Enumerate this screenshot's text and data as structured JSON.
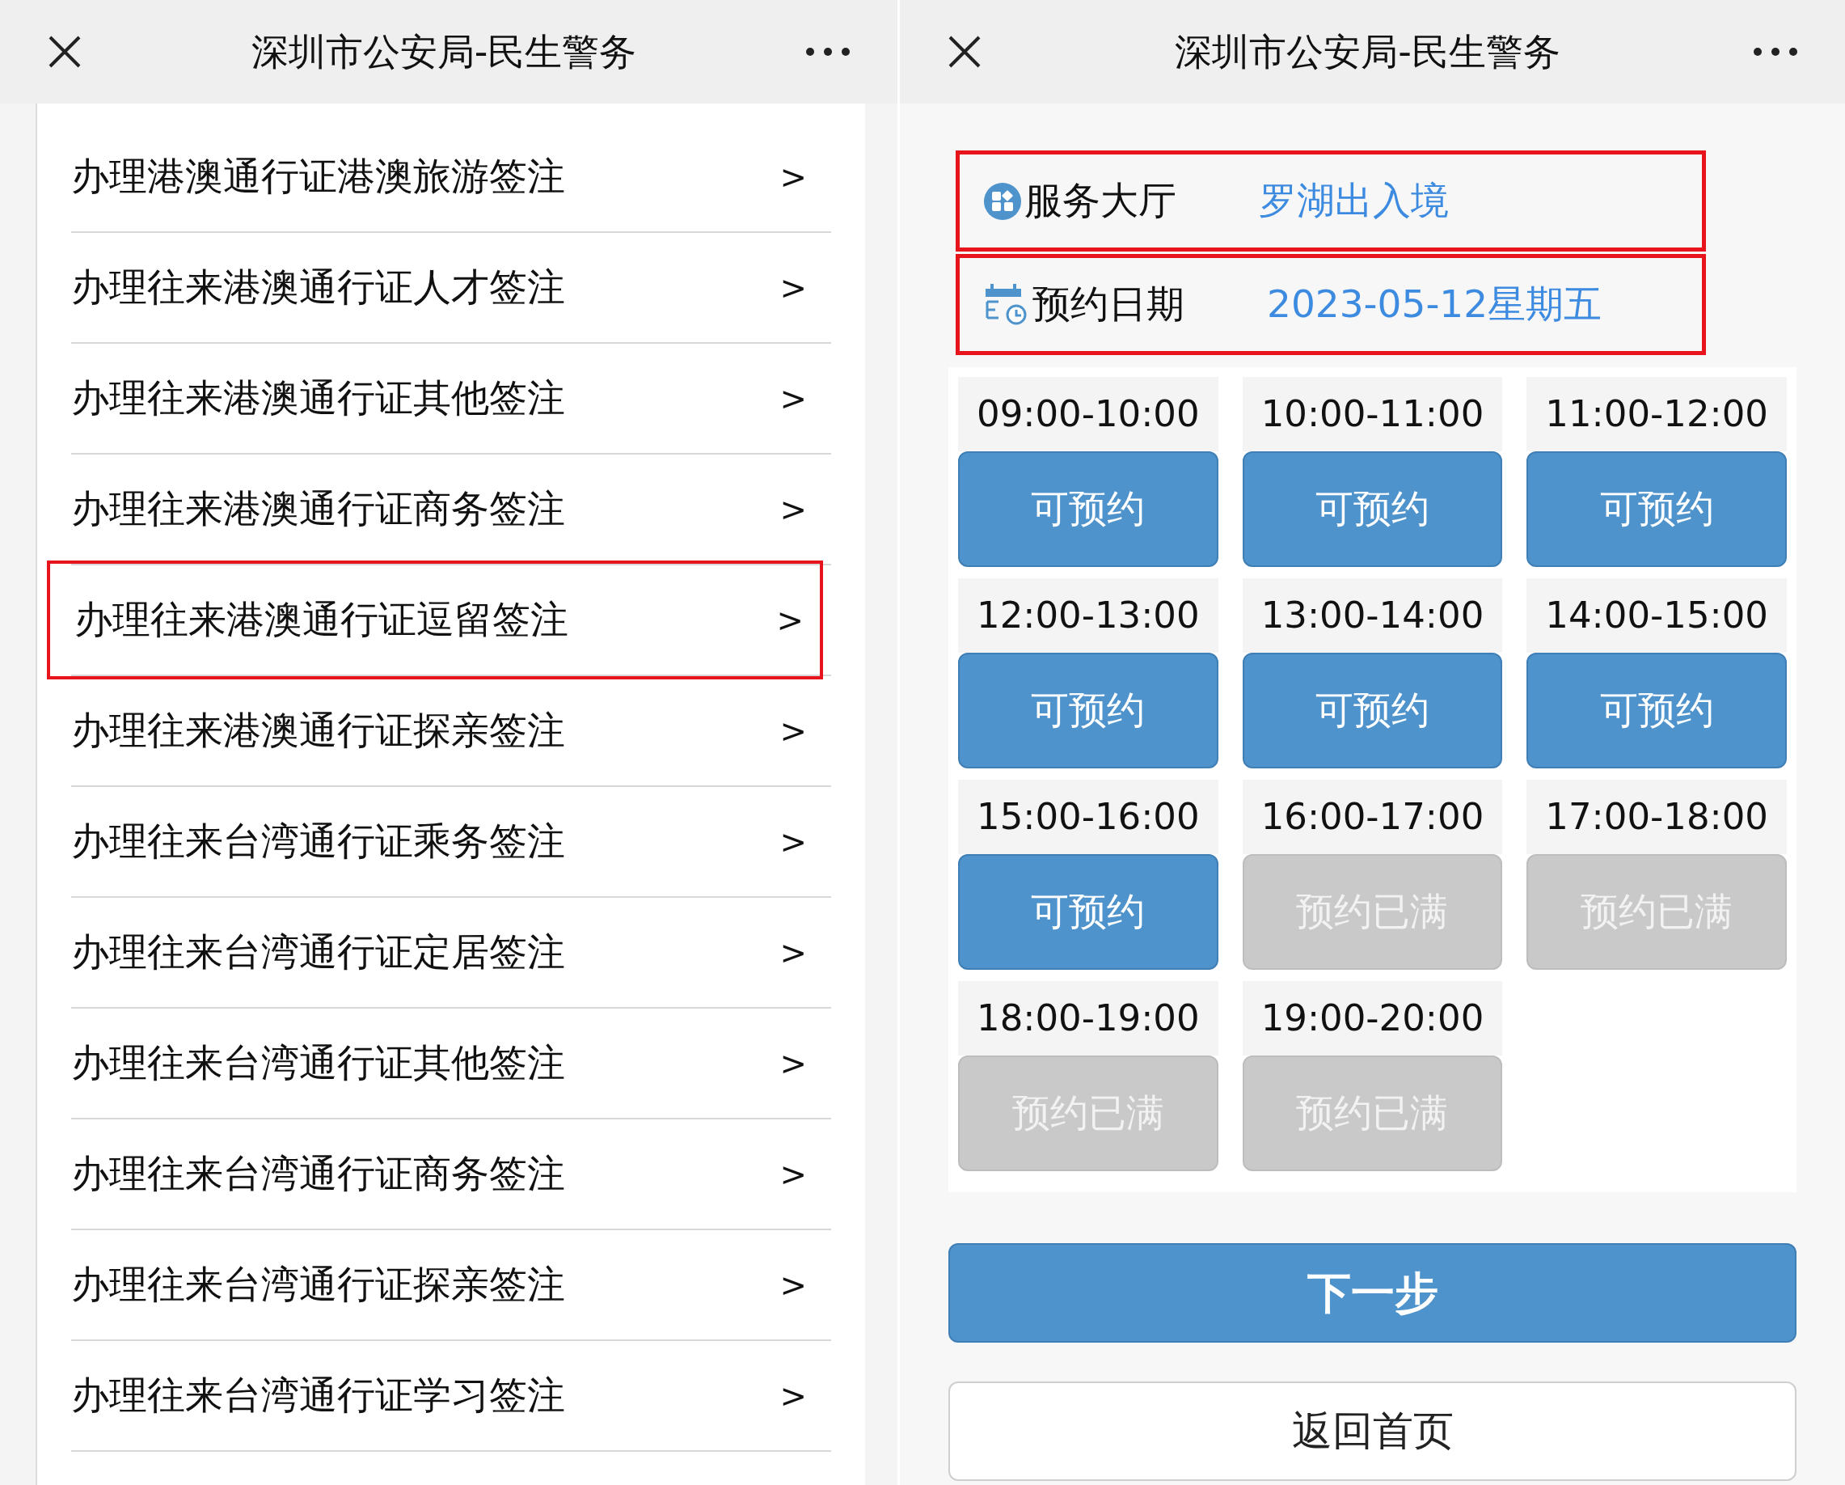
{
  "left_screen": {
    "header": {
      "title": "深圳市公安局-民生警务"
    },
    "items": [
      {
        "label": "办理港澳通行证港澳旅游签注",
        "chevron": ">",
        "highlighted": false
      },
      {
        "label": "办理往来港澳通行证人才签注",
        "chevron": ">",
        "highlighted": false
      },
      {
        "label": "办理往来港澳通行证其他签注",
        "chevron": ">",
        "highlighted": false
      },
      {
        "label": "办理往来港澳通行证商务签注",
        "chevron": ">",
        "highlighted": false
      },
      {
        "label": "办理往来港澳通行证逗留签注",
        "chevron": ">",
        "highlighted": true
      },
      {
        "label": "办理往来港澳通行证探亲签注",
        "chevron": ">",
        "highlighted": false
      },
      {
        "label": "办理往来台湾通行证乘务签注",
        "chevron": ">",
        "highlighted": false
      },
      {
        "label": "办理往来台湾通行证定居签注",
        "chevron": ">",
        "highlighted": false
      },
      {
        "label": "办理往来台湾通行证其他签注",
        "chevron": ">",
        "highlighted": false
      },
      {
        "label": "办理往来台湾通行证商务签注",
        "chevron": ">",
        "highlighted": false
      },
      {
        "label": "办理往来台湾通行证探亲签注",
        "chevron": ">",
        "highlighted": false
      },
      {
        "label": "办理往来台湾通行证学习签注",
        "chevron": ">",
        "highlighted": false
      }
    ]
  },
  "right_screen": {
    "header": {
      "title": "深圳市公安局-民生警务"
    },
    "info": [
      {
        "kind": "hall",
        "label": "服务大厅",
        "value": "罗湖出入境",
        "highlighted": true
      },
      {
        "kind": "date",
        "label": "预约日期",
        "value": "2023-05-12星期五",
        "highlighted": true
      }
    ],
    "slots": [
      {
        "time": "09:00-10:00",
        "status": "可预约",
        "available": true
      },
      {
        "time": "10:00-11:00",
        "status": "可预约",
        "available": true
      },
      {
        "time": "11:00-12:00",
        "status": "可预约",
        "available": true
      },
      {
        "time": "12:00-13:00",
        "status": "可预约",
        "available": true
      },
      {
        "time": "13:00-14:00",
        "status": "可预约",
        "available": true
      },
      {
        "time": "14:00-15:00",
        "status": "可预约",
        "available": true
      },
      {
        "time": "15:00-16:00",
        "status": "可预约",
        "available": true
      },
      {
        "time": "16:00-17:00",
        "status": "预约已满",
        "available": false
      },
      {
        "time": "17:00-18:00",
        "status": "预约已满",
        "available": false
      },
      {
        "time": "18:00-19:00",
        "status": "预约已满",
        "available": false
      },
      {
        "time": "19:00-20:00",
        "status": "预约已满",
        "available": false
      }
    ],
    "next_button": "下一步",
    "home_button": "返回首页"
  }
}
